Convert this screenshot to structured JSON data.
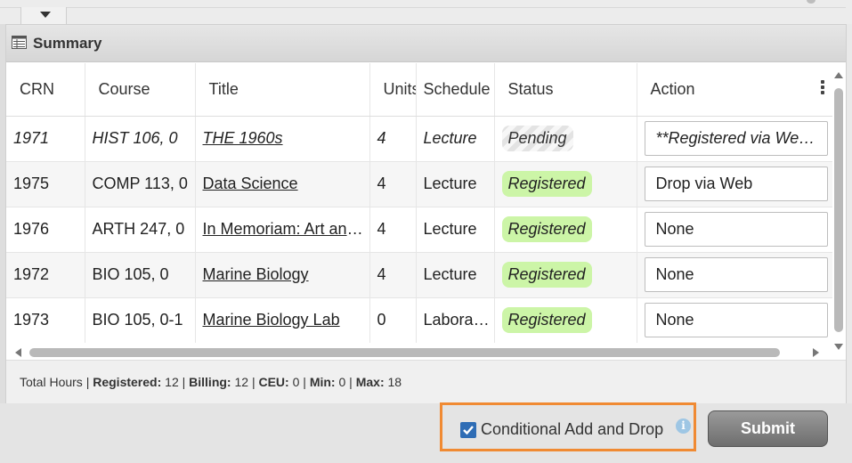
{
  "panel": {
    "title": "Summary",
    "icon": "table-icon"
  },
  "columns": [
    "CRN",
    "Course",
    "Title",
    "Units",
    "Schedule",
    "Status",
    "Action"
  ],
  "rows": [
    {
      "crn": "1971",
      "course": "HIST 106, 0",
      "title": "THE 1960s",
      "units": "4",
      "schedule": "Lecture",
      "status": "Pending",
      "action": "**Registered via Web**"
    },
    {
      "crn": "1975",
      "course": "COMP 113, 0",
      "title": "Data Science",
      "units": "4",
      "schedule": "Lecture",
      "status": "Registered",
      "action": "Drop via Web"
    },
    {
      "crn": "1976",
      "course": "ARTH 247, 0",
      "title": "In Memoriam: Art and Death",
      "units": "4",
      "schedule": "Lecture",
      "status": "Registered",
      "action": "None"
    },
    {
      "crn": "1972",
      "course": "BIO 105, 0",
      "title": "Marine Biology",
      "units": "4",
      "schedule": "Lecture",
      "status": "Registered",
      "action": "None"
    },
    {
      "crn": "1973",
      "course": "BIO 105, 0-1",
      "title": "Marine Biology Lab",
      "units": "0",
      "schedule": "Laboratory",
      "status": "Registered",
      "action": "None"
    }
  ],
  "totals": {
    "label": "Total Hours",
    "sep": "|",
    "registered_label": "Registered:",
    "registered": "12",
    "billing_label": "Billing:",
    "billing": "12",
    "ceu_label": "CEU:",
    "ceu": "0",
    "min_label": "Min:",
    "min": "0",
    "max_label": "Max:",
    "max": "18"
  },
  "footer": {
    "conditional_label": "Conditional Add and Drop",
    "conditional_checked": true,
    "info_glyph": "i",
    "submit_label": "Submit"
  },
  "colors": {
    "registered_badge": "#ccf5a7",
    "highlight_border": "#f08a33",
    "checkbox": "#2f6db5"
  }
}
